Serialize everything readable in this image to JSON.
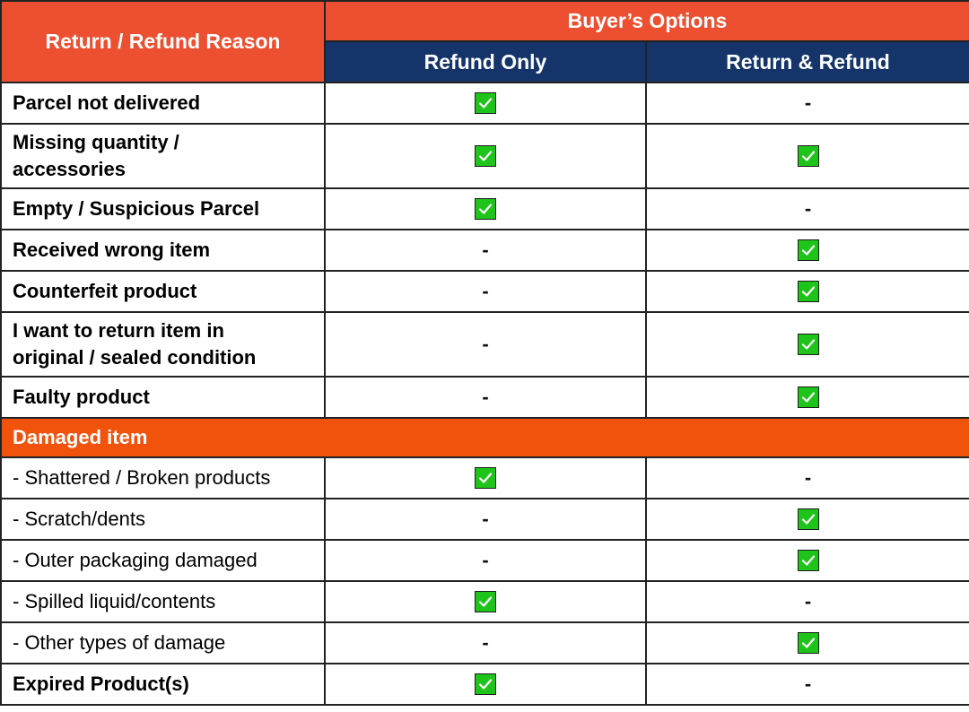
{
  "header": {
    "reason_label": "Return / Refund Reason",
    "options_label": "Buyer’s Options",
    "columns": [
      "Refund Only",
      "Return & Refund"
    ]
  },
  "rows": [
    {
      "reason": "Parcel not delivered",
      "bold": true,
      "refund_only": true,
      "return_refund": false
    },
    {
      "reason": "Missing quantity / accessories",
      "bold": true,
      "refund_only": true,
      "return_refund": true
    },
    {
      "reason": "Empty / Suspicious Parcel",
      "bold": true,
      "refund_only": true,
      "return_refund": false
    },
    {
      "reason": "Received wrong item",
      "bold": true,
      "refund_only": false,
      "return_refund": true
    },
    {
      "reason": "Counterfeit product",
      "bold": true,
      "refund_only": false,
      "return_refund": true
    },
    {
      "reason": "I want to return item in original / sealed condition",
      "bold": true,
      "refund_only": false,
      "return_refund": true
    },
    {
      "reason": "Faulty product",
      "bold": true,
      "refund_only": false,
      "return_refund": true
    }
  ],
  "section": {
    "label": "Damaged item"
  },
  "damaged_rows": [
    {
      "reason": "- Shattered / Broken products",
      "bold": false,
      "refund_only": true,
      "return_refund": false
    },
    {
      "reason": "- Scratch/dents",
      "bold": false,
      "refund_only": false,
      "return_refund": true
    },
    {
      "reason": "- Outer packaging damaged",
      "bold": false,
      "refund_only": false,
      "return_refund": true
    },
    {
      "reason": "- Spilled liquid/contents",
      "bold": false,
      "refund_only": true,
      "return_refund": false
    },
    {
      "reason": "- Other types of damage",
      "bold": false,
      "refund_only": false,
      "return_refund": true
    }
  ],
  "final_rows": [
    {
      "reason": "Expired Product(s)",
      "bold": true,
      "refund_only": true,
      "return_refund": false
    }
  ],
  "symbols": {
    "not_available": "-",
    "available_icon": "checkbox-checked-icon"
  },
  "colors": {
    "header_orange": "#ec5031",
    "header_navy": "#14346a",
    "section_orange": "#f1530d",
    "check_green": "#1fc41a"
  }
}
